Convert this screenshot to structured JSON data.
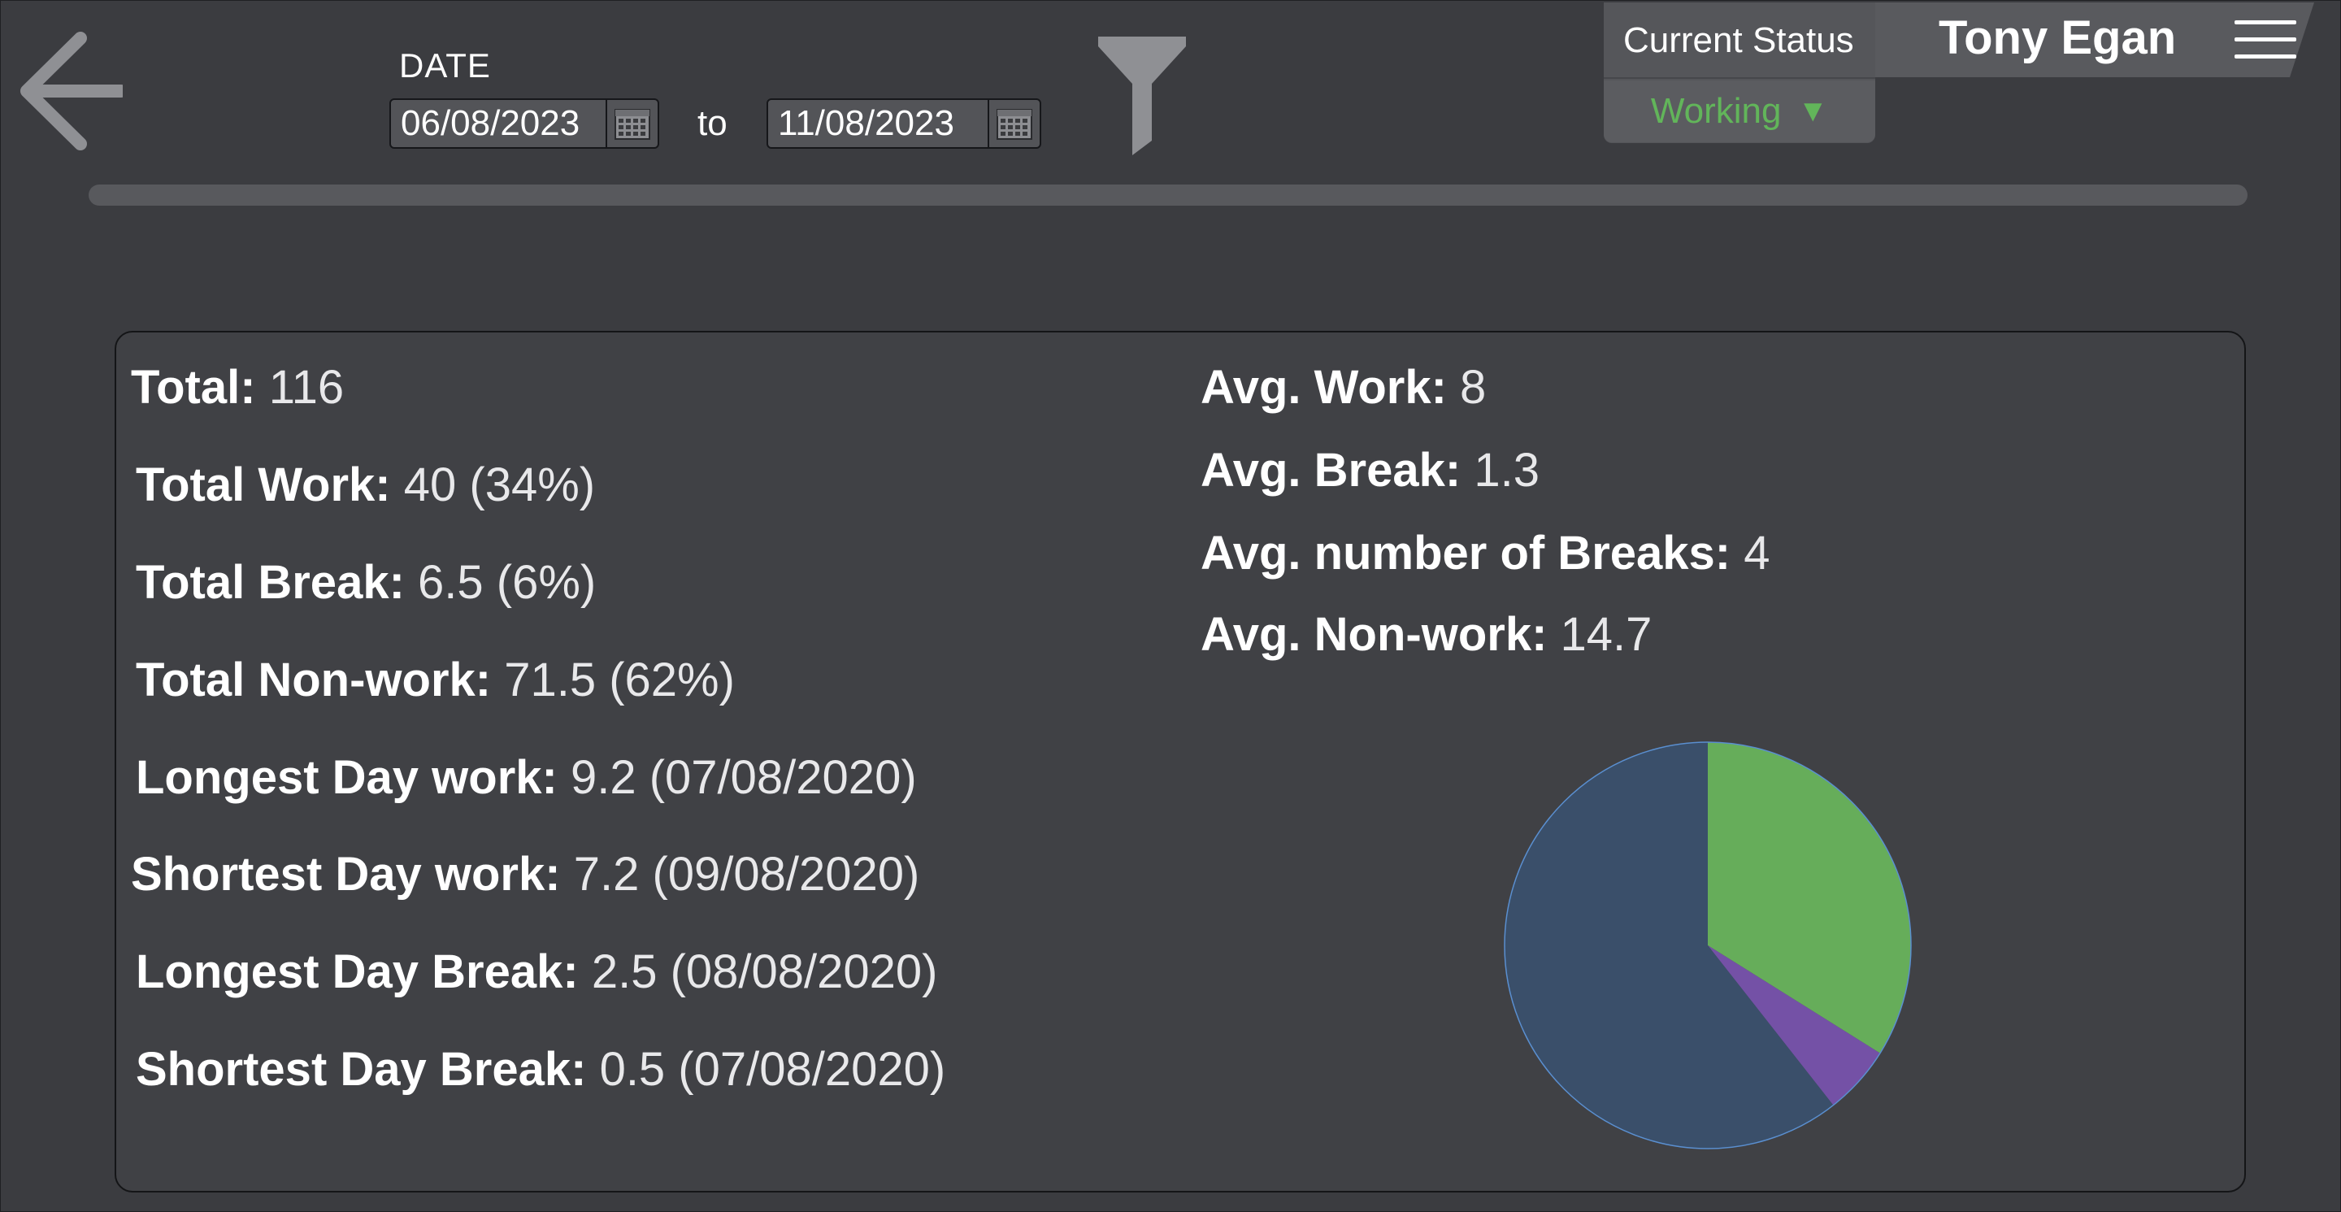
{
  "header": {
    "back_icon": "arrow-left-icon",
    "date_label": "DATE",
    "date_from": "06/08/2023",
    "to_label": "to",
    "date_to": "11/08/2023",
    "calendar_icon": "calendar-icon",
    "filter_icon": "filter-icon"
  },
  "status": {
    "title": "Current Status",
    "value": "Working",
    "caret": "▼"
  },
  "user": {
    "name": "Tony Egan",
    "menu_icon": "hamburger-menu-icon"
  },
  "stats_left": [
    {
      "key": "Total:",
      "value": "116"
    },
    {
      "key": "Total Work:",
      "value": "40 (34%)"
    },
    {
      "key": "Total Break:",
      "value": "6.5 (6%)"
    },
    {
      "key": "Total Non-work:",
      "value": "71.5 (62%)"
    },
    {
      "key": "Longest Day work:",
      "value": "9.2 (07/08/2020)"
    },
    {
      "key": "Shortest Day work:",
      "value": "7.2 (09/08/2020)"
    },
    {
      "key": "Longest Day Break:",
      "value": "2.5 (08/08/2020)"
    },
    {
      "key": "Shortest Day Break:",
      "value": "0.5 (07/08/2020)"
    }
  ],
  "stats_right": [
    {
      "key": "Avg. Work:",
      "value": "8"
    },
    {
      "key": "Avg. Break:",
      "value": "1.3"
    },
    {
      "key": "Avg. number of Breaks:",
      "value": "4"
    },
    {
      "key": "Avg. Non-work:",
      "value": "14.7"
    }
  ],
  "colors": {
    "work": "#66ad5a",
    "break": "#7451a6",
    "nonwork": "#3a4f6a",
    "nonwork_stroke": "#5a8fd0",
    "status_green": "#62b55a"
  },
  "chart_data": {
    "type": "pie",
    "slices": [
      {
        "value": 40,
        "color": "#66ad5a"
      },
      {
        "value": 6.5,
        "color": "#7451a6"
      },
      {
        "value": 71.5,
        "color": "#3a4f6a"
      }
    ]
  }
}
